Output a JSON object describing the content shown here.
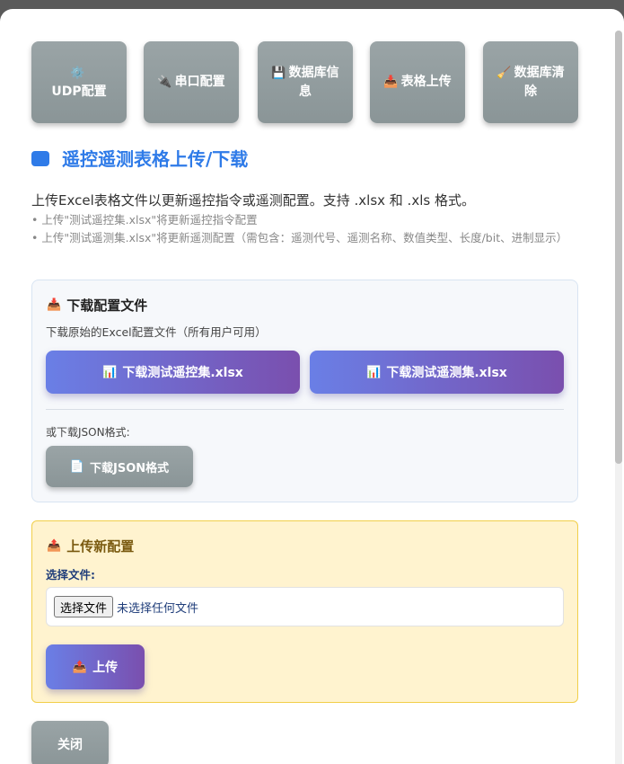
{
  "tabs": [
    {
      "icon": "gear-icon",
      "glyph": "⚙️",
      "label": "UDP配置"
    },
    {
      "icon": "plug-icon",
      "glyph": "🔌",
      "label": "串口配置"
    },
    {
      "icon": "floppy-icon",
      "glyph": "💾",
      "label": "数据库信息"
    },
    {
      "icon": "inbox-upload-icon",
      "glyph": "📥",
      "label": "表格上传"
    },
    {
      "icon": "broom-icon",
      "glyph": "🧹",
      "label": "数据库清除"
    }
  ],
  "section": {
    "title": "遥控遥测表格上传/下载",
    "description": "上传Excel表格文件以更新遥控指令或遥测配置。支持 .xlsx 和 .xls 格式。",
    "note_1": "• 上传\"测试遥控集.xlsx\"将更新遥控指令配置",
    "note_2": "• 上传\"测试遥测集.xlsx\"将更新遥测配置（需包含：遥测代号、遥测名称、数值类型、长度/bit、进制显示）"
  },
  "download_panel": {
    "title": "下载配置文件",
    "subtitle": "下载原始的Excel配置文件（所有用户可用）",
    "button_remote_control": "下载测试遥控集.xlsx",
    "button_telemetry": "下载测试遥测集.xlsx",
    "or_label": "或下载JSON格式:",
    "button_json": "下载JSON格式"
  },
  "upload_panel": {
    "title": "上传新配置",
    "file_label": "选择文件:",
    "file_button": "选择文件",
    "file_status": "未选择任何文件",
    "upload_button": "上传"
  },
  "footer": {
    "close_button": "关闭"
  },
  "colors": {
    "accent_blue": "#2f7be8",
    "button_gradient_start": "#6a7fe6",
    "button_gradient_end": "#7a4fae",
    "tab_gray": "#8f9a9c",
    "upload_bg": "#fff3cf",
    "upload_border": "#f1cf4a"
  }
}
